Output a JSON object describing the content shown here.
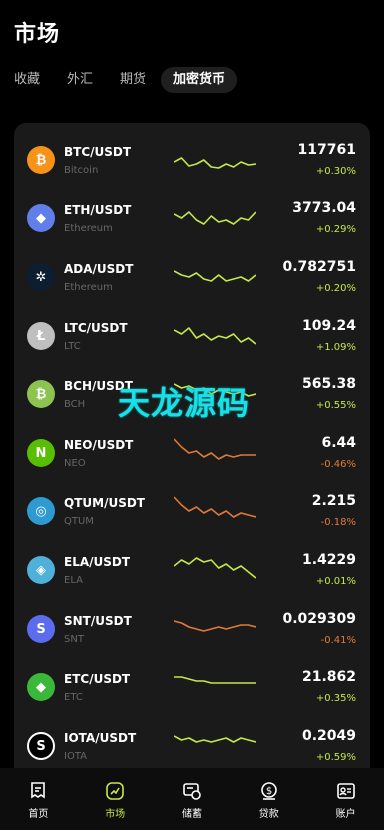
{
  "page": {
    "title": "市场"
  },
  "tabs": [
    {
      "label": "收藏"
    },
    {
      "label": "外汇"
    },
    {
      "label": "期货"
    },
    {
      "label": "加密货币"
    }
  ],
  "coins": [
    {
      "pair": "BTC/USDT",
      "name": "Bitcoin",
      "price": "117761",
      "change": "+0.30%",
      "trend": "up",
      "icon": "bitcoin-icon",
      "icon_color": "#f7931a",
      "glyph": "₿",
      "spark": [
        22,
        18,
        26,
        24,
        20,
        27,
        28,
        24,
        27,
        22,
        25,
        24
      ]
    },
    {
      "pair": "ETH/USDT",
      "name": "Ethereum",
      "price": "3773.04",
      "change": "+0.29%",
      "trend": "up",
      "icon": "ethereum-icon",
      "icon_color": "#627eea",
      "glyph": "◆",
      "spark": [
        16,
        20,
        14,
        22,
        26,
        18,
        24,
        22,
        26,
        20,
        22,
        14
      ]
    },
    {
      "pair": "ADA/USDT",
      "name": "Ethereum",
      "price": "0.782751",
      "change": "+0.20%",
      "trend": "up",
      "icon": "cardano-icon",
      "icon_color": "#0d1e30",
      "glyph": "✲",
      "spark": [
        14,
        18,
        20,
        16,
        22,
        24,
        18,
        24,
        22,
        20,
        24,
        18
      ]
    },
    {
      "pair": "LTC/USDT",
      "name": "LTC",
      "price": "109.24",
      "change": "+1.09%",
      "trend": "up",
      "icon": "litecoin-icon",
      "icon_color": "#bfbfbf",
      "glyph": "Ł",
      "spark": [
        14,
        18,
        12,
        22,
        18,
        24,
        20,
        22,
        18,
        26,
        22,
        28
      ]
    },
    {
      "pair": "BCH/USDT",
      "name": "BCH",
      "price": "565.38",
      "change": "+0.55%",
      "trend": "up",
      "icon": "bitcoin-cash-icon",
      "icon_color": "#8dc351",
      "glyph": "₿",
      "spark": [
        10,
        14,
        12,
        16,
        14,
        20,
        16,
        18,
        20,
        18,
        22,
        20
      ]
    },
    {
      "pair": "NEO/USDT",
      "name": "NEO",
      "price": "6.44",
      "change": "-0.46%",
      "trend": "down",
      "icon": "neo-icon",
      "icon_color": "#58bf00",
      "glyph": "N",
      "spark": [
        6,
        14,
        20,
        18,
        24,
        20,
        26,
        22,
        24,
        22,
        22,
        22
      ]
    },
    {
      "pair": "QTUM/USDT",
      "name": "QTUM",
      "price": "2.215",
      "change": "-0.18%",
      "trend": "down",
      "icon": "qtum-icon",
      "icon_color": "#2e9ad0",
      "glyph": "◎",
      "spark": [
        6,
        14,
        20,
        16,
        22,
        18,
        24,
        20,
        26,
        22,
        24,
        26
      ]
    },
    {
      "pair": "ELA/USDT",
      "name": "ELA",
      "price": "1.4229",
      "change": "+0.01%",
      "trend": "up",
      "icon": "elastos-icon",
      "icon_color": "#4fb0d9",
      "glyph": "◈",
      "spark": [
        16,
        10,
        14,
        8,
        12,
        10,
        18,
        14,
        20,
        16,
        22,
        28
      ]
    },
    {
      "pair": "SNT/USDT",
      "name": "SNT",
      "price": "0.029309",
      "change": "-0.41%",
      "trend": "down",
      "icon": "status-icon",
      "icon_color": "#5b6dee",
      "glyph": "S",
      "spark": [
        12,
        14,
        18,
        20,
        22,
        20,
        18,
        20,
        18,
        16,
        16,
        18
      ]
    },
    {
      "pair": "ETC/USDT",
      "name": "ETC",
      "price": "21.862",
      "change": "+0.35%",
      "trend": "up",
      "icon": "ethereum-classic-icon",
      "icon_color": "#3ab83a",
      "glyph": "◆",
      "spark": [
        10,
        10,
        12,
        14,
        14,
        16,
        16,
        16,
        16,
        16,
        16,
        16
      ]
    },
    {
      "pair": "IOTA/USDT",
      "name": "IOTA",
      "price": "0.2049",
      "change": "+0.59%",
      "trend": "up",
      "icon": "iota-icon",
      "icon_color": "#ffffff",
      "glyph": "S",
      "spark": [
        10,
        14,
        12,
        16,
        14,
        16,
        14,
        12,
        16,
        12,
        14,
        16
      ]
    }
  ],
  "watermark": "天龙源码",
  "nav": [
    {
      "label": "首页",
      "icon": "home-icon",
      "active": false
    },
    {
      "label": "市场",
      "icon": "market-chart-icon",
      "active": true
    },
    {
      "label": "储蓄",
      "icon": "savings-icon",
      "active": false
    },
    {
      "label": "贷款",
      "icon": "loan-icon",
      "active": false
    },
    {
      "label": "账户",
      "icon": "account-icon",
      "active": false
    }
  ],
  "colors": {
    "accent": "#c5e84a",
    "up": "#c5e84a",
    "down": "#e07a3a",
    "background": "#000000",
    "card": "#1a1a1a"
  }
}
